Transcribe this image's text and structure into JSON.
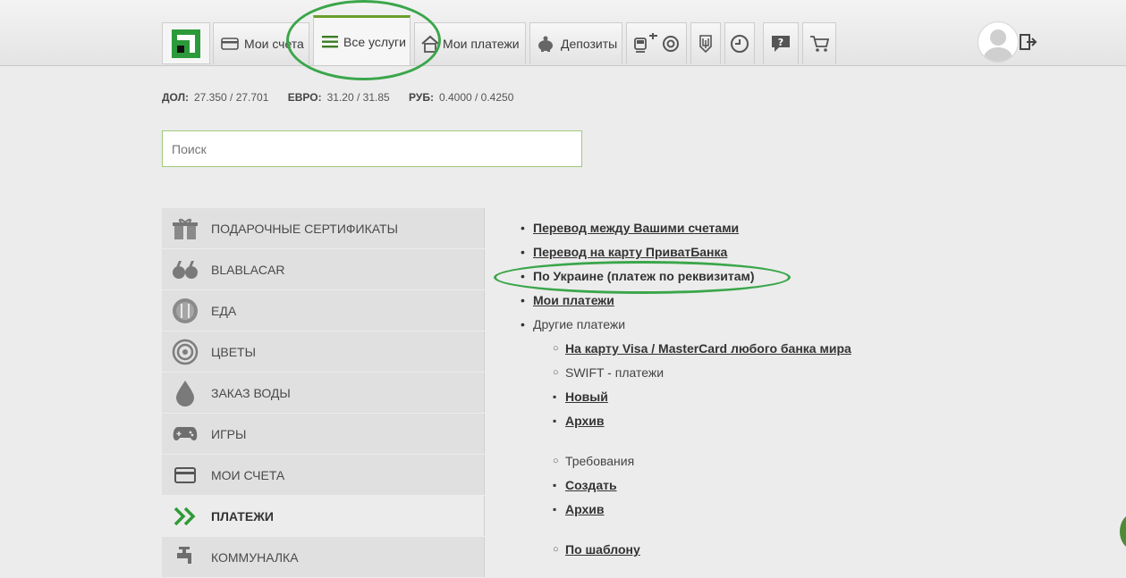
{
  "nav": {
    "tabs": [
      {
        "label": "Мои счета",
        "icon": "card-icon"
      },
      {
        "label": "Все услуги",
        "icon": "list-icon",
        "active": true
      },
      {
        "label": "Мои платежи",
        "icon": "house-icon"
      },
      {
        "label": "Депозиты",
        "icon": "piggy-bank-icon"
      }
    ],
    "icon_tabs": [
      "transport-icon",
      "lifebuoy-icon",
      "ukraine-emblem-icon",
      "history-icon",
      "help-icon",
      "cart-icon"
    ],
    "accent_color": "#6a9e2d"
  },
  "rates": [
    {
      "label": "ДОЛ:",
      "value": "27.350 / 27.701"
    },
    {
      "label": "ЕВРО:",
      "value": "31.20 / 31.85"
    },
    {
      "label": "РУБ:",
      "value": "0.4000 / 0.4250"
    }
  ],
  "search": {
    "placeholder": "Поиск"
  },
  "sidebar": {
    "items": [
      {
        "label": "ПОДАРОЧНЫЕ СЕРТИФИКАТЫ",
        "icon": "gift-icon"
      },
      {
        "label": "BLABLACAR",
        "icon": "quote-icon"
      },
      {
        "label": "ЕДА",
        "icon": "food-icon"
      },
      {
        "label": "ЦВЕТЫ",
        "icon": "flower-icon"
      },
      {
        "label": "ЗАКАЗ ВОДЫ",
        "icon": "water-drop-icon"
      },
      {
        "label": "ИГРЫ",
        "icon": "gamepad-icon"
      },
      {
        "label": "МОИ СЧЕТА",
        "icon": "card-icon"
      },
      {
        "label": "ПЛАТЕЖИ",
        "icon": "double-chevron-icon",
        "selected": true
      },
      {
        "label": "КОММУНАЛКА",
        "icon": "faucet-icon"
      }
    ]
  },
  "payments": {
    "transfer_own": "Перевод между Вашими счетами",
    "transfer_card": "Перевод на карту ПриватБанка",
    "by_ukraine": "По Украине (платеж по реквизитам)",
    "my_payments": "Мои платежи",
    "other": "Другие платежи",
    "to_card_any_bank": "На карту Visa / MasterCard любого банка мира",
    "swift": "SWIFT - платежи",
    "swift_new": "Новый",
    "swift_archive": "Архив",
    "requirements": "Требования",
    "req_create": "Создать",
    "req_archive": "Архив",
    "by_template": "По шаблону"
  }
}
